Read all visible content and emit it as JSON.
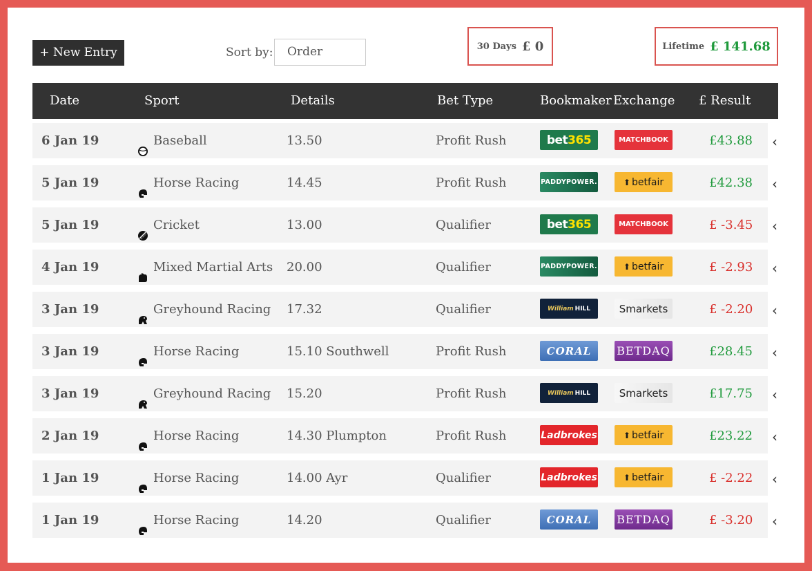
{
  "toolbar": {
    "new_entry_label": "+ New Entry",
    "sort_label": "Sort by:",
    "sort_value": "Order"
  },
  "stats": {
    "days30_label": "30 Days",
    "days30_value": "£ 0",
    "lifetime_label": "Lifetime",
    "lifetime_value": "£ 141.68"
  },
  "table": {
    "headers": {
      "date": "Date",
      "sport": "Sport",
      "details": "Details",
      "bet_type": "Bet Type",
      "bookmaker": "Bookmaker",
      "exchange": "Exchange",
      "result": "£ Result"
    },
    "rows": [
      {
        "date": "6 Jan 19",
        "sport": "Baseball",
        "sport_icon": "baseball-icon",
        "details": "13.50",
        "bet_type": "Profit Rush",
        "bookmaker": "bet365",
        "exchange": "MATCHBOOK",
        "result": "£43.88",
        "result_positive": true
      },
      {
        "date": "5 Jan 19",
        "sport": "Horse Racing",
        "sport_icon": "horse-racing-icon",
        "details": "14.45",
        "bet_type": "Profit Rush",
        "bookmaker": "PADDYPOWER.",
        "exchange": "betfair",
        "result": "£42.38",
        "result_positive": true
      },
      {
        "date": "5 Jan 19",
        "sport": "Cricket",
        "sport_icon": "cricket-icon",
        "details": "13.00",
        "bet_type": "Qualifier",
        "bookmaker": "bet365",
        "exchange": "MATCHBOOK",
        "result": "£ -3.45",
        "result_positive": false
      },
      {
        "date": "4 Jan 19",
        "sport": "Mixed Martial Arts",
        "sport_icon": "mma-glove-icon",
        "details": "20.00",
        "bet_type": "Qualifier",
        "bookmaker": "PADDYPOWER.",
        "exchange": "betfair",
        "result": "£ -2.93",
        "result_positive": false
      },
      {
        "date": "3 Jan 19",
        "sport": "Greyhound Racing",
        "sport_icon": "greyhound-icon",
        "details": "17.32",
        "bet_type": "Qualifier",
        "bookmaker": "William HILL",
        "exchange": "Smarkets",
        "result": "£ -2.20",
        "result_positive": false
      },
      {
        "date": "3 Jan 19",
        "sport": "Horse Racing",
        "sport_icon": "horse-racing-icon",
        "details": "15.10 Southwell",
        "bet_type": "Profit Rush",
        "bookmaker": "CORAL",
        "exchange": "BETDAQ",
        "result": "£28.45",
        "result_positive": true
      },
      {
        "date": "3 Jan 19",
        "sport": "Greyhound Racing",
        "sport_icon": "greyhound-icon",
        "details": "15.20",
        "bet_type": "Profit Rush",
        "bookmaker": "William HILL",
        "exchange": "Smarkets",
        "result": "£17.75",
        "result_positive": true
      },
      {
        "date": "2 Jan 19",
        "sport": "Horse Racing",
        "sport_icon": "horse-racing-icon",
        "details": "14.30 Plumpton",
        "bet_type": "Profit Rush",
        "bookmaker": "Ladbrokes",
        "exchange": "betfair",
        "result": "£23.22",
        "result_positive": true
      },
      {
        "date": "1 Jan 19",
        "sport": "Horse Racing",
        "sport_icon": "horse-racing-icon",
        "details": "14.00 Ayr",
        "bet_type": "Qualifier",
        "bookmaker": "Ladbrokes",
        "exchange": "betfair",
        "result": "£ -2.22",
        "result_positive": false
      },
      {
        "date": "1 Jan 19",
        "sport": "Horse Racing",
        "sport_icon": "horse-racing-icon",
        "details": "14.20",
        "bet_type": "Qualifier",
        "bookmaker": "CORAL",
        "exchange": "BETDAQ",
        "result": "£ -3.20",
        "result_positive": false
      }
    ]
  },
  "colors": {
    "frame": "#e55a55",
    "header_bg": "#333333",
    "positive": "#1f9a3c",
    "negative": "#d9302c"
  }
}
